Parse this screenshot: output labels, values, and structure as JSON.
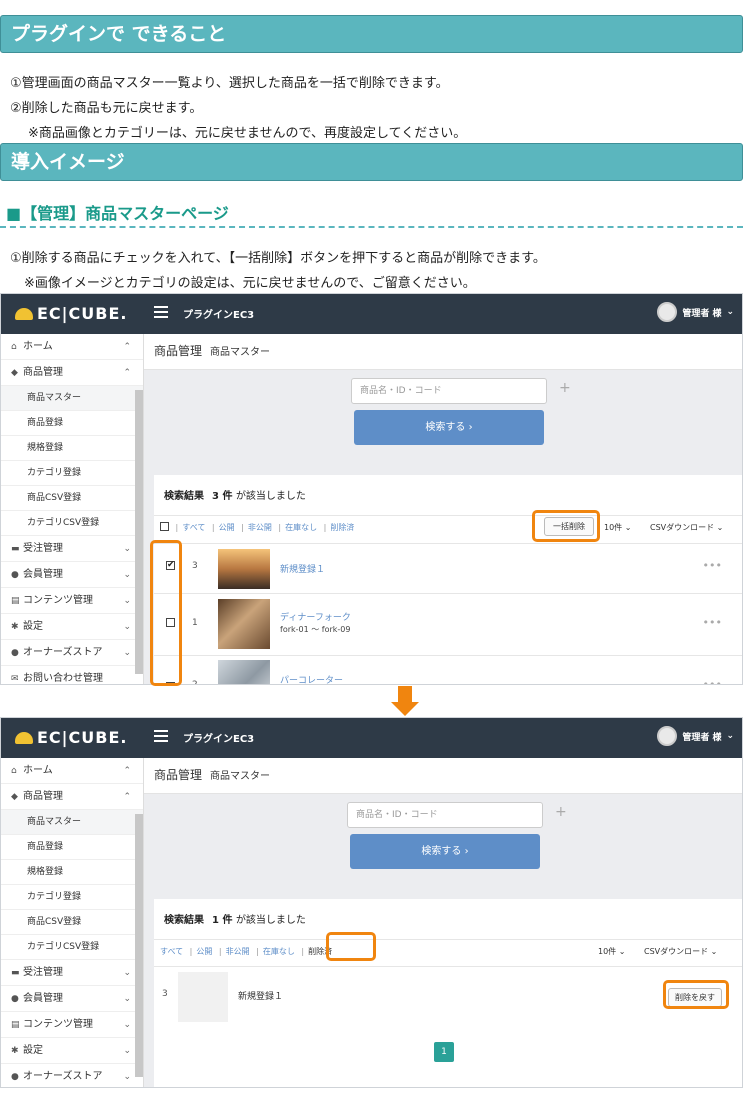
{
  "sections": {
    "plugin_title": "プラグインで できること",
    "plugin_lines": [
      "①管理画面の商品マスター一覧より、選択した商品を一括で削除できます。",
      "②削除した商品も元に戻せます。",
      "※商品画像とカテゴリーは、元に戻せませんので、再度設定してください。"
    ],
    "intro_title": "導入イメージ",
    "subheading": "■【管理】商品マスターページ",
    "intro_lines": [
      "①削除する商品にチェックを入れて、【一括削除】ボタンを押下すると商品が削除できます。",
      "※画像イメージとカテゴリの設定は、元に戻せませんので、ご留意ください。"
    ]
  },
  "app": {
    "logo": "EC|CUBE.",
    "plugin_name": "プラグインEC3",
    "user": "管理者 様"
  },
  "sidebar": {
    "home": "ホーム",
    "products": "商品管理",
    "product_master": "商品マスター",
    "product_register": "商品登録",
    "spec_register": "規格登録",
    "category_register": "カテゴリ登録",
    "product_csv": "商品CSV登録",
    "category_csv": "カテゴリCSV登録",
    "orders": "受注管理",
    "members": "会員管理",
    "contents": "コンテンツ管理",
    "settings": "設定",
    "store": "オーナーズストア",
    "cut_item": "お問い合わせ管理"
  },
  "breadcrumb": {
    "section": "商品管理",
    "page": "商品マスター"
  },
  "search": {
    "placeholder": "商品名・ID・コード",
    "button": "検索する ›"
  },
  "shot1": {
    "result_label": "検索結果",
    "count": "3 件",
    "count_suffix": "が該当しました",
    "bulk_delete": "一括削除",
    "page_size": "10件 ⌄",
    "csv": "CSVダウンロード ⌄",
    "products": [
      {
        "id": "3",
        "name": "新規登録１",
        "code": ""
      },
      {
        "id": "1",
        "name": "ディナーフォーク",
        "code": "fork-01 ～ fork-09"
      },
      {
        "id": "2",
        "name": "パーコレーター",
        "code": ""
      }
    ]
  },
  "filters": {
    "all": "すべて",
    "public": "公開",
    "private": "非公開",
    "no_stock": "在庫なし",
    "deleted": "削除済"
  },
  "shot2": {
    "result_label": "検索結果",
    "count": "1 件",
    "count_suffix": "が該当しました",
    "page_size": "10件 ⌄",
    "csv": "CSVダウンロード ⌄",
    "product": {
      "id": "3",
      "name": "新規登録１"
    },
    "restore": "削除を戻す",
    "page": "1"
  }
}
